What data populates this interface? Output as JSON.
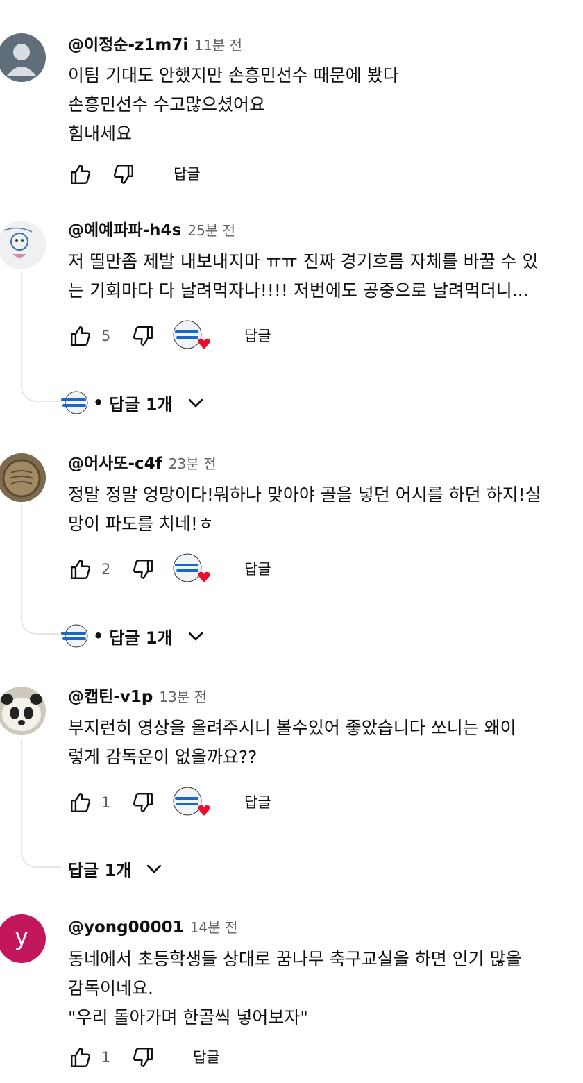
{
  "comments": [
    {
      "author": "@이정순-z1m7i",
      "time": "11분 전",
      "lines": [
        "이팀 기대도 안했지만  손흥민선수 때문에 봤다",
        "손흥민선수   수고많으셨어요",
        "힘내세요"
      ],
      "likes": "",
      "reply_label": "답글",
      "avatar": "default-gray-person"
    },
    {
      "author": "@예예파파-h4s",
      "time": "25분 전",
      "lines": [
        "저 띨만좀 제발 내보내지마 ㅠㅠ 진짜 경기흐름 자체를 바꿀 수 있",
        "는 기회마다 다 날려먹자나!!!! 저번에도 공중으로 날려먹더니..."
      ],
      "likes": "5",
      "reply_label": "답글",
      "avatar": "drawing-photo",
      "replies_label": "답글 1개",
      "dot": "•"
    },
    {
      "author": "@어사또-c4f",
      "time": "23분 전",
      "lines": [
        "정말 정말 엉망이다!뭐하나 맞아야 골을 넣던 어시를 하던 하지!실",
        "망이 파도를 치네!ㅎ"
      ],
      "likes": "2",
      "reply_label": "답글",
      "avatar": "coin-photo",
      "replies_label": "답글 1개",
      "dot": "•"
    },
    {
      "author": "@캡틴-v1p",
      "time": "13분 전",
      "lines": [
        "부지런히 영상을  올려주시니 볼수있어 좋았습니다  쏘니는 왜이",
        "렇게 감독운이 없을까요??"
      ],
      "likes": "1",
      "reply_label": "답글",
      "avatar": "panda-photo",
      "replies_label": "답글 1개"
    },
    {
      "author": "@yong00001",
      "time": "14분 전",
      "lines": [
        "동네에서 초등학생들 상대로 꿈나무 축구교실을 하면 인기 많을",
        "감독이네요.",
        "\"우리 돌아가며 한골씩 넣어보자\""
      ],
      "likes": "1",
      "reply_label": "답글",
      "avatar": "letter-y",
      "avatar_letter": "y",
      "avatar_color": "#c2185b"
    }
  ],
  "colors": {
    "text": "#0f0f0f",
    "secondary": "#606060",
    "heart": "#e8102a",
    "divider": "#e5e5e5"
  },
  "icons": [
    "like-icon",
    "dislike-icon",
    "creator-heart-icon",
    "chevron-down-icon"
  ]
}
